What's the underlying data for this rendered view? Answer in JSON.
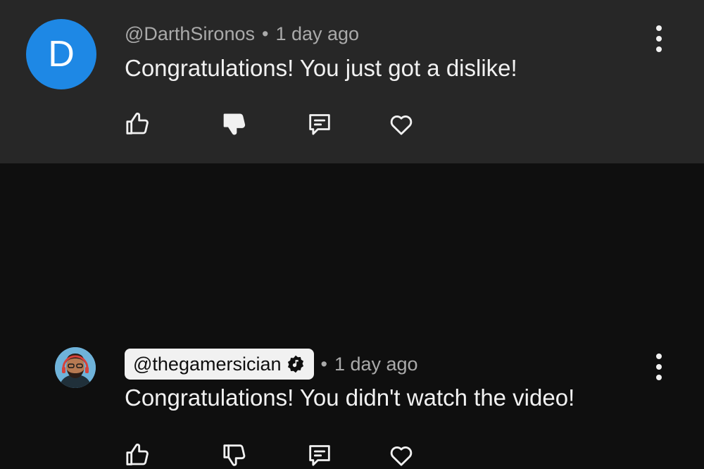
{
  "comments": [
    {
      "avatar_letter": "D",
      "avatar_color": "#1e88e5",
      "author": "@DarthSironos",
      "separator": "•",
      "time": "1 day ago",
      "text": "Congratulations! You just got a dislike!",
      "disliked": true,
      "actions": [
        "like-icon",
        "dislike-icon",
        "reply-icon",
        "heart-icon",
        "more-vertical-icon"
      ]
    },
    {
      "avatar_letter": "",
      "author": "@thegamersician",
      "author_is_creator": true,
      "separator": "•",
      "time": "1 day ago",
      "text": "Congratulations! You didn't watch the video!",
      "disliked": false,
      "actions": [
        "like-icon",
        "dislike-icon",
        "reply-icon",
        "heart-icon",
        "more-vertical-icon"
      ]
    }
  ],
  "colors": {
    "highlight_background": "#272727",
    "page_background": "#0f0f0f",
    "secondary_text": "#aaaaaa",
    "primary_text": "#f1f1f1"
  }
}
